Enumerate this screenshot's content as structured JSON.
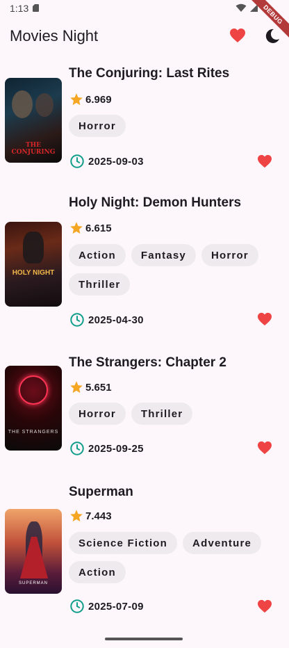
{
  "status_bar": {
    "time": "1:13",
    "debug_label": "DEBUG"
  },
  "app_bar": {
    "title": "Movies Night",
    "favorites_icon": "heart-icon",
    "theme_icon": "moon-icon"
  },
  "colors": {
    "heart": "#ef4444",
    "star": "#f5a623",
    "clock": "#0f9e8a",
    "chip_bg": "#eeeaee"
  },
  "movies": [
    {
      "title": "The Conjuring: Last Rites",
      "rating": "6.969",
      "genres": [
        "Horror"
      ],
      "release_date": "2025-09-03",
      "poster_text": "THE CONJURING",
      "favorite": true
    },
    {
      "title": "Holy Night: Demon Hunters",
      "rating": "6.615",
      "genres": [
        "Action",
        "Fantasy",
        "Horror",
        "Thriller"
      ],
      "release_date": "2025-04-30",
      "poster_text": "HOLY NIGHT",
      "favorite": true
    },
    {
      "title": "The Strangers: Chapter 2",
      "rating": "5.651",
      "genres": [
        "Horror",
        "Thriller"
      ],
      "release_date": "2025-09-25",
      "poster_text": "THE STRANGERS",
      "favorite": true
    },
    {
      "title": "Superman",
      "rating": "7.443",
      "genres": [
        "Science Fiction",
        "Adventure",
        "Action"
      ],
      "release_date": "2025-07-09",
      "poster_text": "SUPERMAN",
      "favorite": true
    }
  ]
}
